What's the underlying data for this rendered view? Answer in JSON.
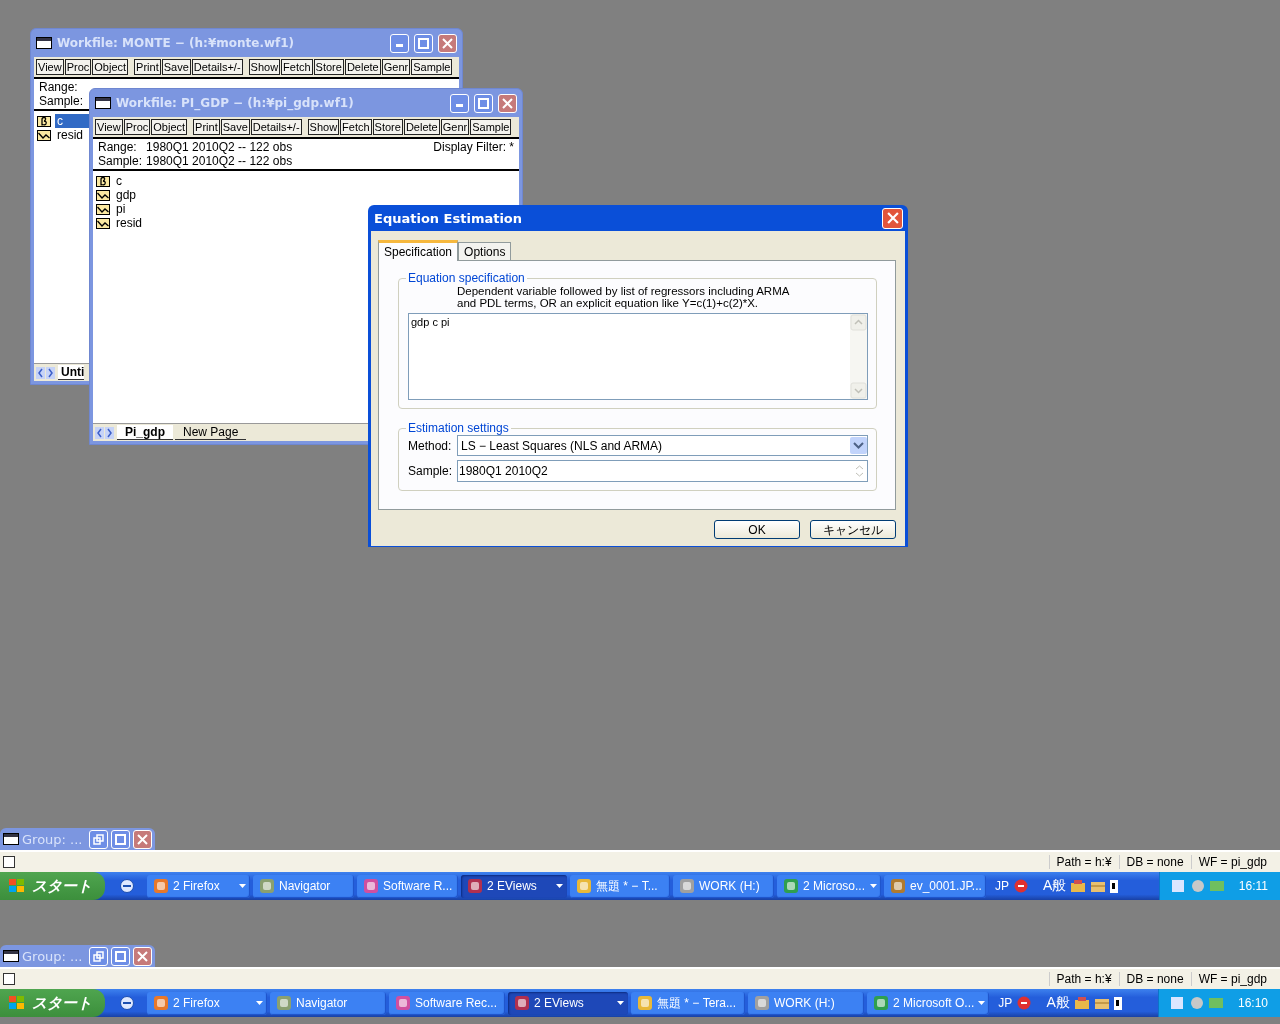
{
  "windows": [
    {
      "title": "Workfile: MONTE − (h:¥monte.wf1)",
      "toolbar": [
        "View",
        "Proc",
        "Object",
        "Print",
        "Save",
        "Details+/-",
        "Show",
        "Fetch",
        "Store",
        "Delete",
        "Genr",
        "Sample"
      ],
      "range_label": "Range:",
      "sample_label": "Sample:",
      "objects": [
        {
          "name": "c",
          "kind": "coef",
          "selected": true
        },
        {
          "name": "resid",
          "kind": "series",
          "selected": false
        }
      ],
      "pages": [
        {
          "label": "Unti",
          "selected": true
        }
      ]
    },
    {
      "title": "Workfile: PI_GDP − (h:¥pi_gdp.wf1)",
      "toolbar": [
        "View",
        "Proc",
        "Object",
        "Print",
        "Save",
        "Details+/-",
        "Show",
        "Fetch",
        "Store",
        "Delete",
        "Genr",
        "Sample"
      ],
      "range_label": "Range:",
      "range_value": "1980Q1 2010Q2  --  122 obs",
      "sample_label": "Sample:",
      "sample_value": "1980Q1 2010Q2  --  122 obs",
      "filter": "Display Filter: *",
      "objects": [
        {
          "name": "c",
          "kind": "coef",
          "selected": false
        },
        {
          "name": "gdp",
          "kind": "series",
          "selected": false
        },
        {
          "name": "pi",
          "kind": "series",
          "selected": false
        },
        {
          "name": "resid",
          "kind": "series",
          "selected": false
        }
      ],
      "pages": [
        {
          "label": "Pi_gdp",
          "selected": true
        },
        {
          "label": "New Page",
          "selected": false
        }
      ]
    }
  ],
  "dialog": {
    "title": "Equation Estimation",
    "tabs": [
      {
        "label": "Specification",
        "selected": true
      },
      {
        "label": "Options",
        "selected": false
      }
    ],
    "spec": {
      "legend": "Equation specification",
      "hint": "Dependent variable followed by list of regressors including ARMA\nand PDL terms, OR an explicit equation like Y=c(1)+c(2)*X.",
      "value": "gdp c pi"
    },
    "settings": {
      "legend": "Estimation settings",
      "method_label": "Method:",
      "method_value": "LS  −  Least Squares (NLS and ARMA)",
      "sample_label": "Sample:",
      "sample_value": "1980Q1 2010Q2"
    },
    "buttons": [
      "OK",
      "キャンセル"
    ]
  },
  "snapshots": [
    {
      "group_title": "Group: ...",
      "status_checked": false,
      "status": [
        "Path = h:¥",
        "DB = none",
        "WF = pi_gdp"
      ],
      "start": "スタート",
      "buttons": [
        {
          "label": "2 Firefox",
          "selected": false,
          "dropdown": true
        },
        {
          "label": "Navigator",
          "selected": false,
          "dropdown": false
        },
        {
          "label": "Software R...",
          "selected": false,
          "dropdown": false
        },
        {
          "label": "2 EViews",
          "selected": true,
          "dropdown": true
        },
        {
          "label": "無題 * − T...",
          "selected": false,
          "dropdown": false
        },
        {
          "label": "WORK (H:)",
          "selected": false,
          "dropdown": false
        },
        {
          "label": "2 Microso...",
          "selected": false,
          "dropdown": true
        },
        {
          "label": "ev_0001.JP...",
          "selected": false,
          "dropdown": false
        }
      ],
      "lang": "JP",
      "ime": "A般",
      "clock": "16:11"
    },
    {
      "group_title": "Group: ...",
      "status_checked": false,
      "status": [
        "Path = h:¥",
        "DB = none",
        "WF = pi_gdp"
      ],
      "start": "スタート",
      "buttons": [
        {
          "label": "2 Firefox",
          "selected": false,
          "dropdown": true
        },
        {
          "label": "Navigator",
          "selected": false,
          "dropdown": false
        },
        {
          "label": "Software Rec...",
          "selected": false,
          "dropdown": false
        },
        {
          "label": "2 EViews",
          "selected": true,
          "dropdown": true
        },
        {
          "label": "無題 * − Tera...",
          "selected": false,
          "dropdown": false
        },
        {
          "label": "WORK (H:)",
          "selected": false,
          "dropdown": false
        },
        {
          "label": "2 Microsoft O...",
          "selected": false,
          "dropdown": true
        }
      ],
      "lang": "JP",
      "ime": "A般",
      "clock": "16:10"
    }
  ]
}
